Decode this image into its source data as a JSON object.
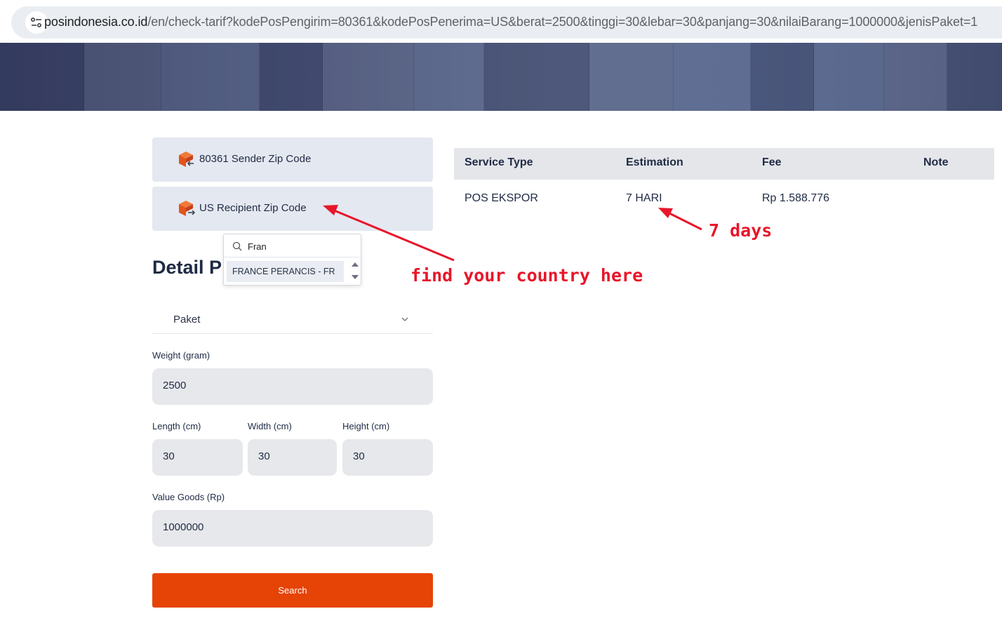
{
  "browser": {
    "url_host": "posindonesia.co.id",
    "url_path": "/en/check-tarif?kodePosPengirim=80361&kodePosPenerima=US&berat=2500&tinggi=30&lebar=30&panjang=30&nilaiBarang=1000000&jenisPaket=1"
  },
  "form": {
    "sender_label": "80361 Sender Zip Code",
    "recipient_label": "US Recipient Zip Code",
    "dropdown": {
      "search_value": "Fran",
      "option": "FRANCE PERANCIS - FR"
    },
    "detail_title": "Detail P",
    "package_type": "Paket",
    "weight_label": "Weight (gram)",
    "weight_value": "2500",
    "length_label": "Length (cm)",
    "length_value": "30",
    "width_label": "Width (cm)",
    "width_value": "30",
    "height_label": "Height (cm)",
    "height_value": "30",
    "value_label": "Value Goods (Rp)",
    "value_value": "1000000",
    "search_label": "Search"
  },
  "results": {
    "headers": [
      "Service Type",
      "Estimation",
      "Fee",
      "Note"
    ],
    "rows": [
      [
        "POS EKSPOR",
        "7 HARI",
        "Rp 1.588.776",
        ""
      ]
    ]
  },
  "annotations": {
    "country_note": "find your country here",
    "days_note": "7 days",
    "color": "#e8162a"
  },
  "colors": {
    "accent": "#e64306",
    "card_bg": "#e4e8f0",
    "field_bg": "#e7e8eb",
    "text": "#1f2a44"
  },
  "icons": {
    "site_info": "tune-icon",
    "sender": "box-arrow-in-icon",
    "recipient": "box-arrow-out-icon",
    "search": "search-icon",
    "select": "chevron-down-icon"
  }
}
